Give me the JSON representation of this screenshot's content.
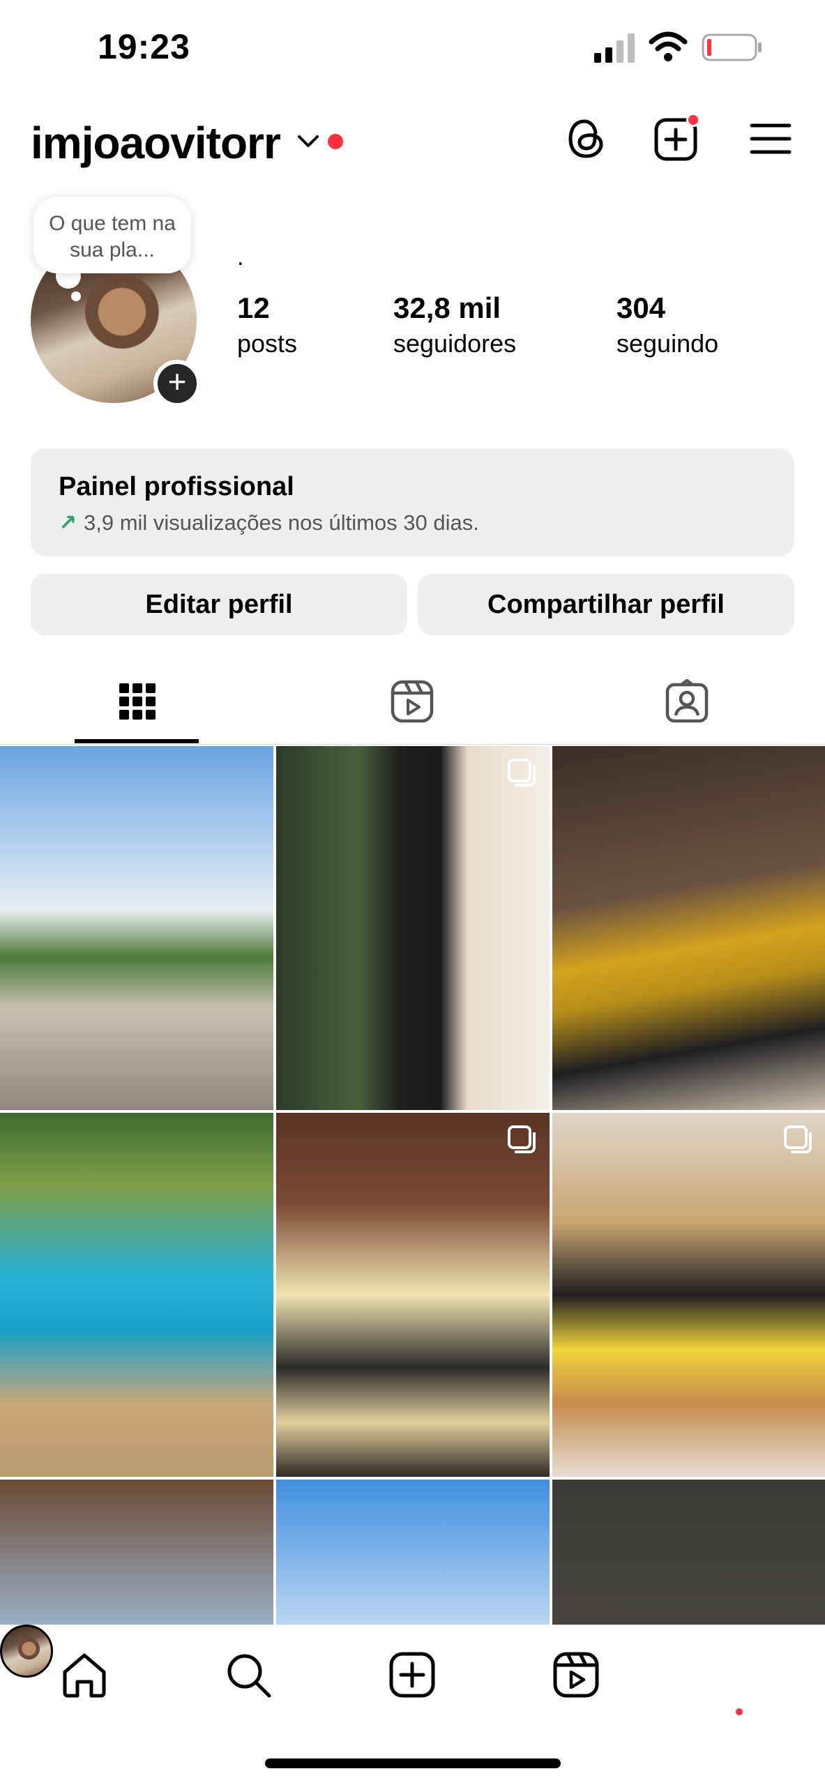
{
  "status_bar": {
    "time": "19:23"
  },
  "header": {
    "username": "imjoaovitorr"
  },
  "profile": {
    "note": "O que tem na sua pla...",
    "bio": ".",
    "stats": {
      "posts_value": "12",
      "posts_label": "posts",
      "followers_value": "32,8 mil",
      "followers_label": "seguidores",
      "following_value": "304",
      "following_label": "seguindo"
    }
  },
  "pro_panel": {
    "title": "Painel profissional",
    "arrow": "↗",
    "subtitle": "3,9 mil visualizações nos últimos 30 dias."
  },
  "buttons": {
    "edit": "Editar perfil",
    "share": "Compartilhar perfil"
  },
  "tabs": [
    {
      "name": "grid",
      "icon": "grid-icon",
      "selected": true
    },
    {
      "name": "reels",
      "icon": "reels-icon",
      "selected": false
    },
    {
      "name": "tagged",
      "icon": "tagged-icon",
      "selected": false
    }
  ],
  "grid": {
    "posts": [
      {
        "multi": false
      },
      {
        "multi": true
      },
      {
        "multi": false
      },
      {
        "multi": false
      },
      {
        "multi": true
      },
      {
        "multi": true
      },
      {
        "multi": false
      },
      {
        "multi": false
      },
      {
        "multi": false
      }
    ]
  },
  "nav": [
    "home-icon",
    "search-icon",
    "create-icon",
    "reels-icon",
    "profile-avatar"
  ],
  "colors": {
    "notification_red": "#ff3040",
    "panel_bg": "#efeff0",
    "trend_green": "#2aa36c"
  }
}
